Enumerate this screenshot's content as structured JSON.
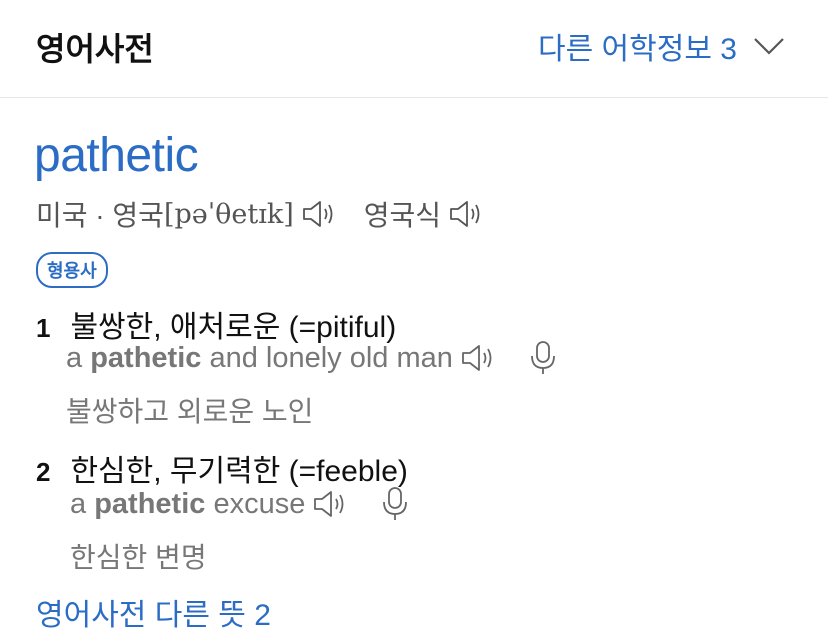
{
  "header": {
    "title": "영어사전",
    "other_info": "다른 어학정보 3"
  },
  "entry": {
    "word": "pathetic",
    "pronunciation": {
      "region1": "미국 · 영국",
      "ipa": "[pəˈθetɪk]",
      "region2": "영국식"
    },
    "pos": "형용사",
    "senses": [
      {
        "num": "1",
        "meaning": "불쌍한, 애처로운 (=pitiful)",
        "example": {
          "pre": "a",
          "bold": "pathetic",
          "post": "and lonely old man"
        },
        "translation": "불쌍하고 외로운 노인"
      },
      {
        "num": "2",
        "meaning": "한심한, 무기력한 (=feeble)",
        "example": {
          "pre": "a",
          "bold": "pathetic",
          "post": "excuse"
        },
        "translation": "한심한 변명"
      }
    ]
  },
  "footer": {
    "more_meanings": "영어사전 다른 뜻 2"
  },
  "colors": {
    "accent": "#2b6cc4",
    "muted": "#777777"
  },
  "icons": [
    "chevron-down-icon",
    "speaker-icon",
    "microphone-icon"
  ]
}
